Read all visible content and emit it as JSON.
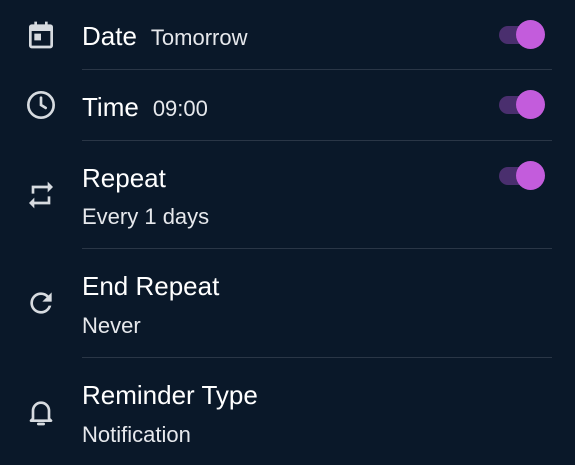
{
  "settings": {
    "date": {
      "label": "Date",
      "value": "Tomorrow",
      "enabled": true
    },
    "time": {
      "label": "Time",
      "value": "09:00",
      "enabled": true
    },
    "repeat": {
      "label": "Repeat",
      "value": "Every 1 days",
      "enabled": true
    },
    "end_repeat": {
      "label": "End Repeat",
      "value": "Never"
    },
    "reminder_type": {
      "label": "Reminder Type",
      "value": "Notification"
    }
  },
  "icons": {
    "date": "calendar-icon",
    "time": "clock-icon",
    "repeat": "repeat-icon",
    "end_repeat": "refresh-icon",
    "reminder_type": "bell-icon"
  },
  "colors": {
    "background": "#0a1829",
    "toggle_thumb": "#c35cdc",
    "toggle_track": "#4a2f6e"
  }
}
